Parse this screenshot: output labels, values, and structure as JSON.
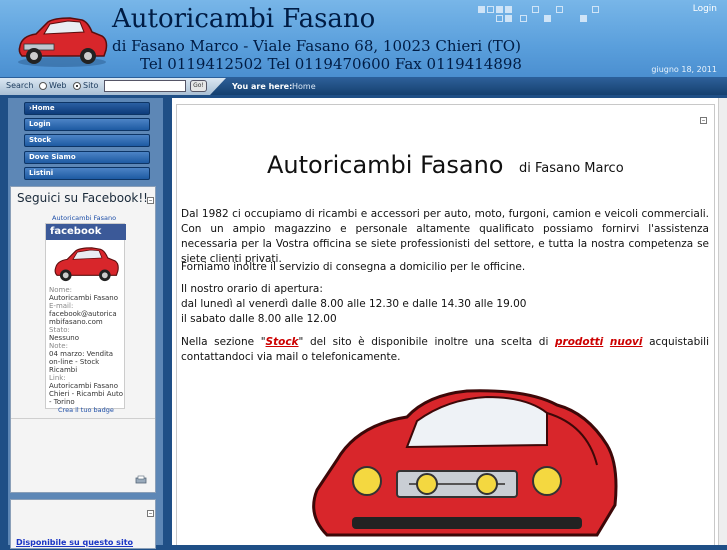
{
  "header": {
    "title": "Autoricambi Fasano",
    "line2": "di Fasano Marco  - Viale Fasano 68, 10023 Chieri (TO)",
    "line3": "Tel 0119412502 Tel 0119470600 Fax 0119414898",
    "login": "Login",
    "date": "giugno 18, 2011",
    "logo_icon": "red-car-icon"
  },
  "search": {
    "label": "Search",
    "option_web": "Web",
    "option_site": "Sito",
    "selected": "Sito",
    "value": "",
    "go_label": "Go!"
  },
  "breadcrumb": {
    "label": "You are here:",
    "current": "Home"
  },
  "menu": {
    "items": [
      {
        "label": "Home",
        "active": true
      },
      {
        "label": "Login",
        "active": false
      },
      {
        "label": "Stock",
        "active": false
      },
      {
        "label": "Dove Siamo",
        "active": false
      },
      {
        "label": "Listini",
        "active": false
      }
    ]
  },
  "facebook_box": {
    "title": "Seguici su Facebook!!",
    "profile_link": "Autoricambi Fasano",
    "logo_text": "facebook",
    "fields": [
      {
        "key": "Nome:",
        "value": "Autoricambi Fasano"
      },
      {
        "key": "E-mail:",
        "value": "facebook@autoricambifasano.com"
      },
      {
        "key": "Stato:",
        "value": "Nessuno"
      },
      {
        "key": "Note:",
        "value": "04 marzo: Vendita on-line - Stock Ricambi"
      },
      {
        "key": "Link:",
        "value": "Autoricambi Fasano Chieri - Ricambi Auto - Torino"
      }
    ],
    "create_badge": "Crea il tuo badge"
  },
  "availability_box": {
    "text": "Disponibile su questo sito"
  },
  "main": {
    "title": "Autoricambi Fasano",
    "subtitle": "di Fasano Marco",
    "para1": "Dal 1982 ci occupiamo di ricambi e accessori per auto, moto, furgoni, camion e veicoli commerciali. Con un ampio magazzino e personale altamente qualificato possiamo fornirvi l'assistenza necessaria per la Vostra officina se siete professionisti del settore, e tutta la nostra competenza se siete clienti privati.",
    "para2": "Forniamo inoltre il servizio di consegna a domicilio per le officine.",
    "hours_title": "Il nostro orario di apertura:",
    "hours_weekdays": "dal lunedì al venerdì dalle 8.00 alle 12.30 e dalle 14.30 alle 19.00",
    "hours_saturday": "il sabato dalle 8.00 alle 12.00",
    "para4_a": "Nella sezione \"",
    "stock_link": "Stock",
    "para4_b": "\" del sito è disponibile inoltre una scelta di ",
    "prodotti_link": "prodotti",
    "nuovi_link": "nuovi",
    "para4_c": " acquistabili contattandoci via mail o telefonicamente."
  },
  "colors": {
    "header_blue": "#5a9fdc",
    "menu_blue": "#1e5aa2",
    "link_red": "#cc0000",
    "car_red": "#d8262b"
  }
}
